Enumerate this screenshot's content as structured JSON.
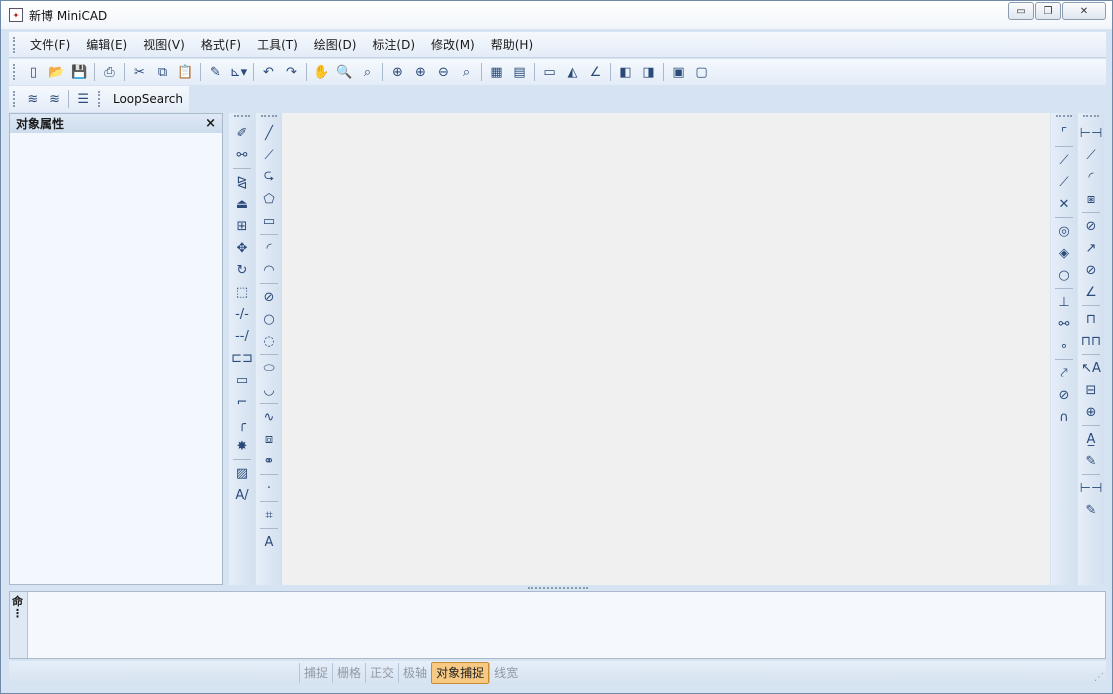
{
  "window": {
    "title": "新博 MiniCAD",
    "controls": {
      "minimize": "▭",
      "restore": "❐",
      "close": "✕"
    }
  },
  "menubar": {
    "items": [
      "文件(F)",
      "编辑(E)",
      "视图(V)",
      "格式(F)",
      "工具(T)",
      "绘图(D)",
      "标注(D)",
      "修改(M)",
      "帮助(H)"
    ]
  },
  "toolbar2": {
    "loop_search_label": "LoopSearch"
  },
  "props_panel": {
    "title": "对象属性",
    "close_glyph": "×"
  },
  "command_panel": {
    "tab_label": "命"
  },
  "statusbar": {
    "items": [
      {
        "label": "捕捉",
        "active": false
      },
      {
        "label": "栅格",
        "active": false
      },
      {
        "label": "正交",
        "active": false
      },
      {
        "label": "极轴",
        "active": false
      },
      {
        "label": "对象捕捉",
        "active": true
      },
      {
        "label": "线宽",
        "active": false
      }
    ]
  },
  "colors": {
    "accent": "#f7c983",
    "canvas": "#f0f0f0",
    "chrome": "#d6e3f3"
  }
}
